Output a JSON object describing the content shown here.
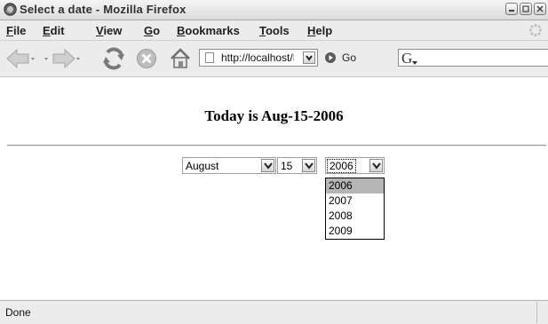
{
  "window": {
    "title": "Select a date - Mozilla Firefox"
  },
  "menu": [
    {
      "u": "F",
      "rest": "ile"
    },
    {
      "u": "E",
      "rest": "dit"
    },
    {
      "u": "V",
      "rest": "iew"
    },
    {
      "u": "G",
      "rest": "o"
    },
    {
      "u": "B",
      "rest": "ookmarks"
    },
    {
      "u": "T",
      "rest": "ools"
    },
    {
      "u": "H",
      "rest": "elp"
    }
  ],
  "navbar": {
    "url": "http://localhost/P",
    "go_label": "Go",
    "search_engine_glyph": "G"
  },
  "page": {
    "heading": "Today is Aug-15-2006",
    "month_value": "August",
    "day_value": "15",
    "year_value": "2006",
    "year_options": [
      "2006",
      "2007",
      "2008",
      "2009"
    ],
    "selected_year_index": 0
  },
  "status": {
    "text": "Done"
  },
  "icons": {
    "app": "firefox-icon",
    "back": "back-arrow-icon",
    "forward": "forward-arrow-icon",
    "reload": "reload-icon",
    "stop": "stop-icon",
    "home": "home-icon"
  }
}
